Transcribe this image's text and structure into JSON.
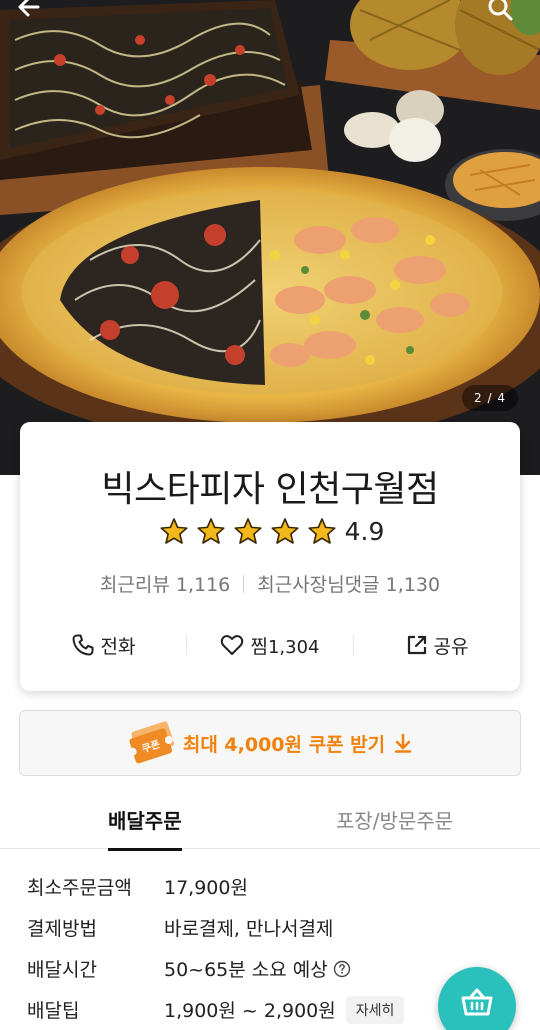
{
  "hero": {
    "page_indicator": "2 / 4"
  },
  "store": {
    "name": "빅스타피자 인천구월점",
    "rating": "4.9",
    "stars": 5,
    "recent_reviews": "최근리뷰 1,116",
    "owner_replies": "최근사장님댓글 1,130",
    "call_label": "전화",
    "like_label": "찜",
    "like_count": "1,304",
    "share_label": "공유"
  },
  "coupon": {
    "icon_label": "쿠폰",
    "text": "최대 4,000원 쿠폰 받기"
  },
  "tabs": {
    "delivery": "배달주문",
    "pickup": "포장/방문주문"
  },
  "info": [
    {
      "label": "최소주문금액",
      "value": "17,900원"
    },
    {
      "label": "결제방법",
      "value": "바로결제, 만나서결제"
    },
    {
      "label": "배달시간",
      "value": "50~65분 소요 예상"
    },
    {
      "label": "배달팁",
      "value": "1,900원 ~ 2,900원",
      "chip": "자세히"
    }
  ],
  "icons": {
    "back": "arrow-left-icon",
    "search": "search-icon",
    "call": "phone-icon",
    "like": "heart-icon",
    "share": "share-icon",
    "coupon": "coupon-ticket-icon",
    "download": "arrow-down-icon",
    "help": "question-circle-icon",
    "cart": "basket-icon"
  },
  "colors": {
    "star": "#f5b81c",
    "coupon_accent": "#f0820d",
    "cart_fab": "#2ac1bc"
  }
}
